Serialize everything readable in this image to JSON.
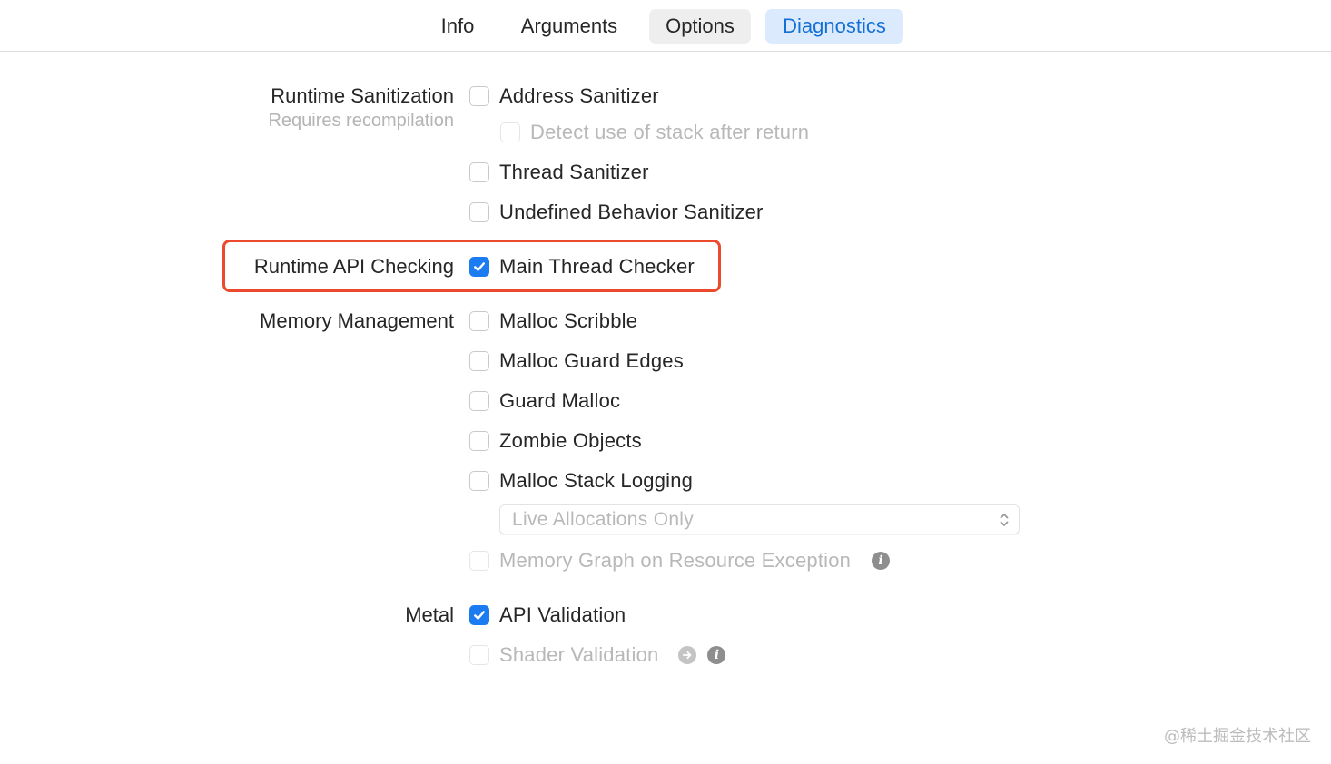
{
  "tabs": {
    "info": "Info",
    "arguments": "Arguments",
    "options": "Options",
    "diagnostics": "Diagnostics",
    "selected": "Diagnostics"
  },
  "runtime_sanitization": {
    "label": "Runtime Sanitization",
    "note": "Requires recompilation",
    "address_sanitizer": {
      "label": "Address Sanitizer",
      "checked": false
    },
    "detect_stack_after_return": {
      "label": "Detect use of stack after return",
      "checked": false,
      "enabled": false
    },
    "thread_sanitizer": {
      "label": "Thread Sanitizer",
      "checked": false
    },
    "undefined_behavior_sanitizer": {
      "label": "Undefined Behavior Sanitizer",
      "checked": false
    }
  },
  "runtime_api_checking": {
    "label": "Runtime API Checking",
    "main_thread_checker": {
      "label": "Main Thread Checker",
      "checked": true
    }
  },
  "memory_management": {
    "label": "Memory Management",
    "malloc_scribble": {
      "label": "Malloc Scribble",
      "checked": false
    },
    "malloc_guard_edges": {
      "label": "Malloc Guard Edges",
      "checked": false
    },
    "guard_malloc": {
      "label": "Guard Malloc",
      "checked": false
    },
    "zombie_objects": {
      "label": "Zombie Objects",
      "checked": false
    },
    "malloc_stack_logging": {
      "label": "Malloc Stack Logging",
      "checked": false
    },
    "stack_logging_mode": {
      "value": "Live Allocations Only",
      "enabled": false
    },
    "memory_graph_on_resource_exception": {
      "label": "Memory Graph on Resource Exception",
      "checked": false,
      "enabled": false
    }
  },
  "metal": {
    "label": "Metal",
    "api_validation": {
      "label": "API Validation",
      "checked": true
    },
    "shader_validation": {
      "label": "Shader Validation",
      "checked": false,
      "enabled": false
    }
  },
  "watermark": "@稀土掘金技术社区",
  "colors": {
    "accent": "#1a7cf0",
    "selected_tab_bg": "#dbeafd",
    "selected_tab_text": "#1470d6",
    "highlight_border": "#ec4a2c"
  }
}
